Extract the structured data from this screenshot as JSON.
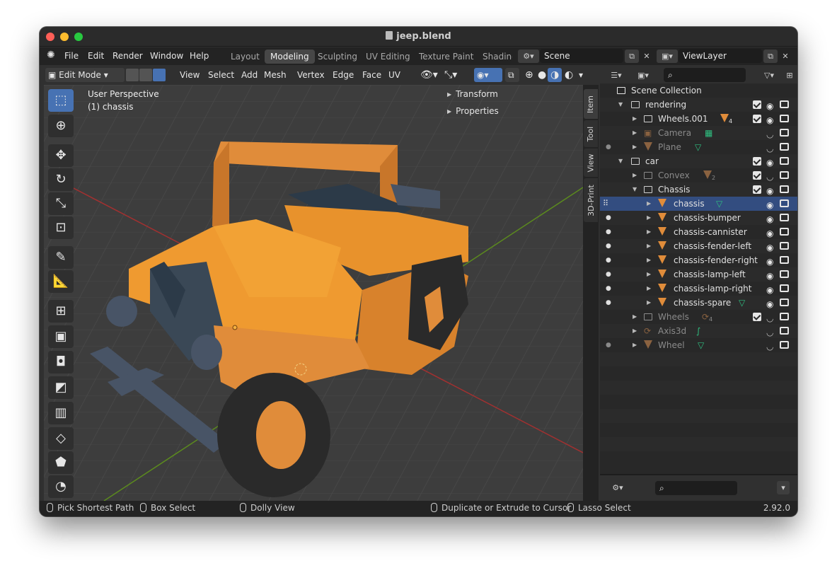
{
  "window": {
    "title": "jeep.blend"
  },
  "menu": [
    "File",
    "Edit",
    "Render",
    "Window",
    "Help"
  ],
  "workspaces": [
    "Layout",
    "Modeling",
    "Sculpting",
    "UV Editing",
    "Texture Paint",
    "Shading"
  ],
  "active_workspace": "Modeling",
  "scene": {
    "name": "Scene"
  },
  "view_layer": {
    "name": "ViewLayer"
  },
  "header": {
    "mode": "Edit Mode",
    "menus": [
      "View",
      "Select",
      "Add",
      "Mesh",
      "Vertex",
      "Edge",
      "Face",
      "UV"
    ]
  },
  "viewport": {
    "perspective": "User Perspective",
    "object": "(1) chassis",
    "npanel": [
      "Transform",
      "Properties"
    ]
  },
  "side_tabs": [
    "Item",
    "Tool",
    "View",
    "3D-Print"
  ],
  "outliner": {
    "root": "Scene Collection",
    "rows": [
      {
        "name": "rendering",
        "badge": ""
      },
      {
        "name": "Wheels.001",
        "badge": "4"
      },
      {
        "name": "Camera",
        "badge": ""
      },
      {
        "name": "Plane",
        "badge": ""
      },
      {
        "name": "car",
        "badge": ""
      },
      {
        "name": "Convex",
        "badge": "2"
      },
      {
        "name": "Chassis",
        "badge": ""
      },
      {
        "name": "chassis",
        "badge": ""
      },
      {
        "name": "chassis-bumper",
        "badge": ""
      },
      {
        "name": "chassis-cannister",
        "badge": ""
      },
      {
        "name": "chassis-fender-left",
        "badge": ""
      },
      {
        "name": "chassis-fender-right",
        "badge": ""
      },
      {
        "name": "chassis-lamp-left",
        "badge": ""
      },
      {
        "name": "chassis-lamp-right",
        "badge": ""
      },
      {
        "name": "chassis-spare",
        "badge": ""
      },
      {
        "name": "Wheels",
        "badge": "4"
      },
      {
        "name": "Axis3d",
        "badge": ""
      },
      {
        "name": "Wheel",
        "badge": ""
      }
    ]
  },
  "statusbar": {
    "hints": [
      "Pick Shortest Path",
      "Box Select",
      "Dolly View",
      "Duplicate or Extrude to Cursor",
      "Lasso Select"
    ],
    "version": "2.92.0"
  },
  "colors": {
    "accent": "#4772b3",
    "selected_row": "#334d80",
    "object_orange": "#e08c3a",
    "mesh_green": "#2fbf80",
    "model_orange": "#e8922c",
    "model_blue": "#4a5a6e"
  }
}
